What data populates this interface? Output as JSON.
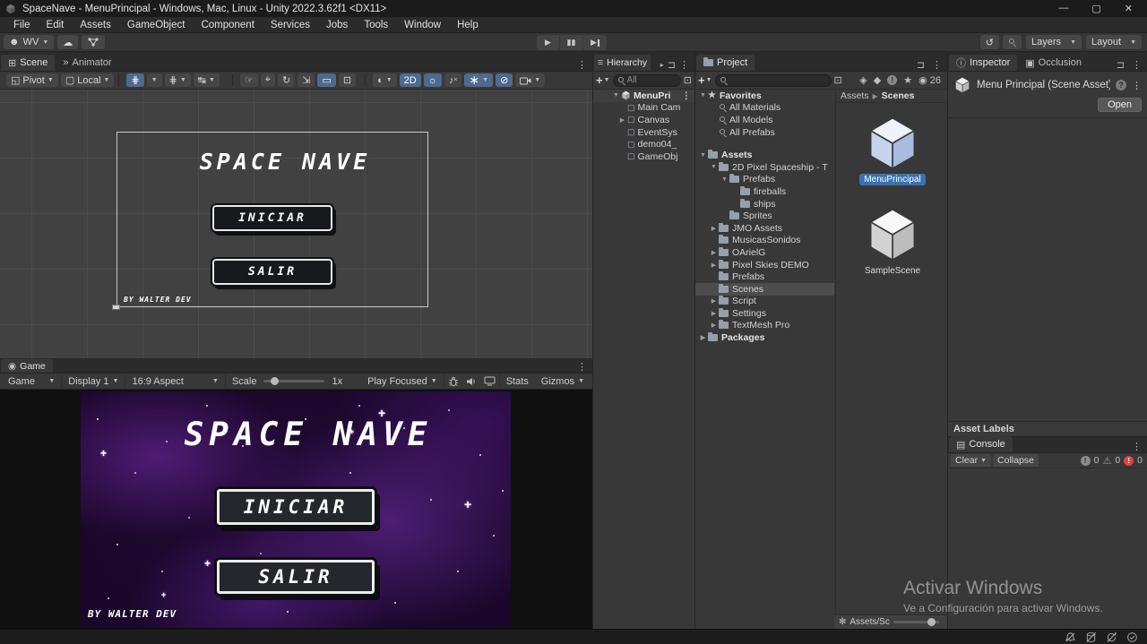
{
  "window": {
    "title": "SpaceNave - MenuPrincipal - Windows, Mac, Linux - Unity 2022.3.62f1 <DX11>",
    "menus": [
      "File",
      "Edit",
      "Assets",
      "GameObject",
      "Component",
      "Services",
      "Jobs",
      "Tools",
      "Window",
      "Help"
    ]
  },
  "toolbar": {
    "account": "WV",
    "layers": "Layers",
    "layout": "Layout"
  },
  "scene": {
    "tab": "Scene",
    "tab2": "Animator",
    "pivot": "Pivot",
    "local": "Local",
    "mode2d": "2D",
    "title": "SPACE NAVE",
    "buttons": [
      "INICIAR",
      "SALIR"
    ],
    "credit": "BY WALTER DEV"
  },
  "game": {
    "tab": "Game",
    "display_target": "Game",
    "display": "Display 1",
    "aspect": "16:9 Aspect",
    "scale_label": "Scale",
    "scale_value": "1x",
    "focus": "Play Focused",
    "stats": "Stats",
    "gizmos": "Gizmos",
    "title": "SPACE NAVE",
    "buttons": [
      "INICIAR",
      "SALIR"
    ],
    "credit": "BY WALTER DEV"
  },
  "hierarchy": {
    "tab": "Hierarchy",
    "search_placeholder": "All",
    "scene_item": "MenuPri",
    "items": [
      {
        "label": "Main Cam"
      },
      {
        "label": "Canvas"
      },
      {
        "label": "EventSys"
      },
      {
        "label": "demo04_"
      },
      {
        "label": "GameObj"
      }
    ]
  },
  "project": {
    "tab": "Project",
    "eye_count": "26",
    "breadcrumb": [
      "Assets",
      "Scenes"
    ],
    "tree": [
      {
        "label": "Favorites"
      },
      {
        "label": "All Materials"
      },
      {
        "label": "All Models"
      },
      {
        "label": "All Prefabs"
      },
      {
        "label": "Assets"
      },
      {
        "label": "2D Pixel Spaceship - T"
      },
      {
        "label": "Prefabs"
      },
      {
        "label": "fireballs"
      },
      {
        "label": "ships"
      },
      {
        "label": "Sprites"
      },
      {
        "label": "JMO Assets"
      },
      {
        "label": "MusicasSonidos"
      },
      {
        "label": "OArielG"
      },
      {
        "label": "Pixel Skies DEMO"
      },
      {
        "label": "Prefabs"
      },
      {
        "label": "Scenes"
      },
      {
        "label": "Script"
      },
      {
        "label": "Settings"
      },
      {
        "label": "TextMesh Pro"
      },
      {
        "label": "Packages"
      }
    ],
    "assets": [
      {
        "label": "MenuPrincipal",
        "selected": true
      },
      {
        "label": "SampleScene",
        "selected": false
      }
    ],
    "status_path": "Assets/Sc"
  },
  "inspector": {
    "tab": "Inspector",
    "tab2": "Occlusion",
    "title": "Menu Principal (Scene Asset)",
    "open": "Open",
    "asset_labels": "Asset Labels"
  },
  "console": {
    "tab": "Console",
    "clear": "Clear",
    "collapse": "Collapse",
    "info_count": "0",
    "warn_count": "0",
    "error_count": "0"
  },
  "watermark": {
    "line1": "Activar Windows",
    "line2": "Ve a Configuración para activar Windows."
  },
  "colors": {
    "selection_blue": "#3a72b0",
    "active_tool_blue": "#4f6a8f",
    "error_red": "#e0443f",
    "game_bg_purple": "#2a0d3c"
  }
}
